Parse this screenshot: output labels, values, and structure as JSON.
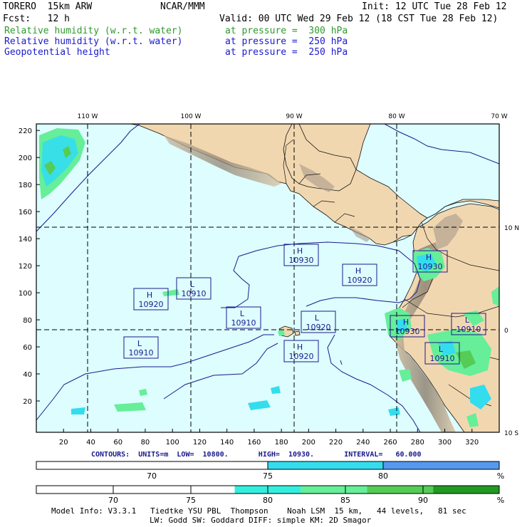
{
  "header": {
    "model": "TORERO  15km ARW",
    "center": "NCAR/MMM",
    "init": "Init: 12 UTC Tue 28 Feb 12",
    "fcst": "Fcst:   12 h",
    "valid": "Valid: 00 UTC Wed 29 Feb 12 (18 CST Tue 28 Feb 12)",
    "fields": [
      {
        "name": "Relative humidity (w.r.t. water)",
        "level": "at pressure =  300 hPa",
        "color": "#2e9a2e"
      },
      {
        "name": "Relative humidity (w.r.t. water)",
        "level": "at pressure =  250 hPa",
        "color": "#1a1acc"
      },
      {
        "name": "Geopotential height",
        "level": "at pressure =  250 hPa",
        "color": "#1a1acc"
      }
    ]
  },
  "map": {
    "top_lon_labels": [
      "110 W",
      "100 W",
      "90 W",
      "80 W",
      "70 W"
    ],
    "right_lat_labels": [
      "10 N",
      "0",
      "10 S"
    ],
    "left_y_labels": [
      "220",
      "200",
      "180",
      "160",
      "140",
      "120",
      "100",
      "80",
      "60",
      "40",
      "20"
    ],
    "bottom_x_labels": [
      "20",
      "40",
      "60",
      "80",
      "100",
      "120",
      "140",
      "160",
      "180",
      "200",
      "220",
      "240",
      "260",
      "280",
      "300",
      "320"
    ],
    "colors": {
      "ocean": "#ddfdff",
      "land": "#f1d7b0",
      "mountain": "#a89a8a",
      "grid": "#000000",
      "contour": "#1a1a8c"
    },
    "centers": [
      {
        "type": "H",
        "value": "10920"
      },
      {
        "type": "L",
        "value": "10910"
      },
      {
        "type": "L",
        "value": "10910"
      },
      {
        "type": "L",
        "value": "10910"
      },
      {
        "type": "H",
        "value": "10930"
      },
      {
        "type": "H",
        "value": "10920"
      },
      {
        "type": "L",
        "value": "10920"
      },
      {
        "type": "H",
        "value": "10920"
      },
      {
        "type": "H",
        "value": "10930"
      },
      {
        "type": "H",
        "value": "10930"
      },
      {
        "type": "L",
        "value": "10910"
      },
      {
        "type": "L",
        "value": "10910"
      }
    ]
  },
  "contours_info": "CONTOURS:  UNITS=m  LOW=  10800.       HIGH=  10930.       INTERVAL=   60.000",
  "colorbars": [
    {
      "unit": "%",
      "labels": [
        "70",
        "75",
        "80"
      ],
      "segments": [
        "#ffffff",
        "#ffffff",
        "#33ddee",
        "#5599ee"
      ]
    },
    {
      "unit": "%",
      "labels": [
        "70",
        "75",
        "80",
        "85",
        "90"
      ],
      "segments": [
        "#ffffff",
        "#ffffff",
        "#ffffff",
        "#33eedd",
        "#66ee99",
        "#55cc55",
        "#229922"
      ]
    }
  ],
  "footer": {
    "line1": "Model Info: V3.3.1   Tiedtke YSU PBL  Thompson    Noah LSM  15 km,   44 levels,   81 sec",
    "line2": "LW: Godd SW: Goddard DIFF: simple KM: 2D Smagor"
  }
}
